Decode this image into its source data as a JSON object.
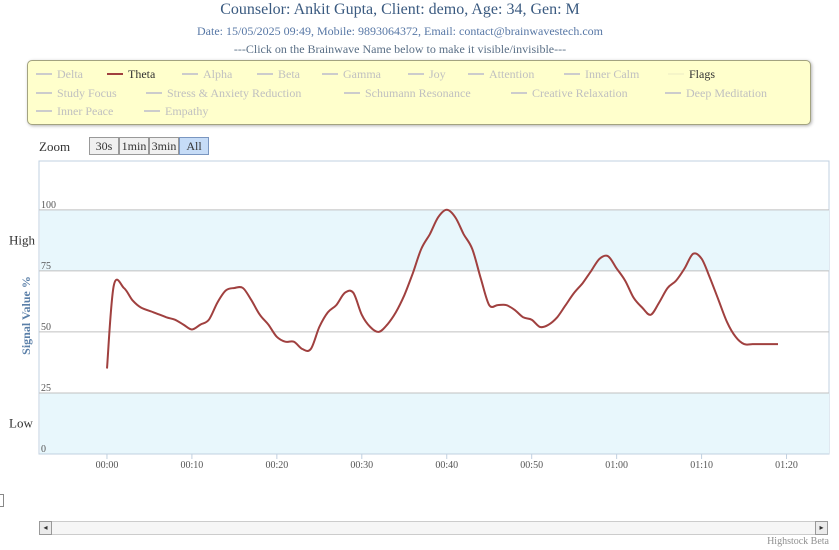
{
  "header": {
    "title": "Counselor: Ankit Gupta, Client: demo, Age: 34, Gen: M",
    "subtitle": "Date: 15/05/2025 09:49, Mobile: 9893064372, Email: contact@brainwavestech.com",
    "hint": "---Click on the Brainwave Name below to make it visible/invisible---"
  },
  "legend": {
    "items": [
      {
        "label": "Delta",
        "visible": false
      },
      {
        "label": "Theta",
        "visible": true,
        "color": "#a0403f"
      },
      {
        "label": "Alpha",
        "visible": false
      },
      {
        "label": "Beta",
        "visible": false
      },
      {
        "label": "Gamma",
        "visible": false
      },
      {
        "label": "Joy",
        "visible": false
      },
      {
        "label": "Attention",
        "visible": false
      },
      {
        "label": "Inner Calm",
        "visible": false
      },
      {
        "label": "Flags",
        "visible": true,
        "color": "#f5f5c8"
      },
      {
        "label": "Study Focus",
        "visible": false
      },
      {
        "label": "Stress & Anxiety Reduction",
        "visible": false
      },
      {
        "label": "Schumann Resonance",
        "visible": false
      },
      {
        "label": "Creative Relaxation",
        "visible": false
      },
      {
        "label": "Deep Meditation",
        "visible": false
      },
      {
        "label": "Inner Peace",
        "visible": false
      },
      {
        "label": "Empathy",
        "visible": false
      }
    ]
  },
  "zoom": {
    "label": "Zoom",
    "buttons": [
      "30s",
      "1min",
      "3min",
      "All"
    ],
    "active": "All"
  },
  "chart_data": {
    "type": "line",
    "ylabel": "Signal Value %",
    "ylim": [
      0,
      120
    ],
    "yticks": [
      0,
      25,
      50,
      75,
      100
    ],
    "bands": [
      {
        "label": "High",
        "from": 75,
        "to": 100,
        "color": "#e8f7fc"
      },
      {
        "label": "Low",
        "from": 0,
        "to": 25,
        "color": "#e8f7fc"
      }
    ],
    "xlim_seconds": [
      -8,
      85
    ],
    "xticks": [
      {
        "label": "00:00",
        "t": 0
      },
      {
        "label": "00:10",
        "t": 10
      },
      {
        "label": "00:20",
        "t": 20
      },
      {
        "label": "00:30",
        "t": 30
      },
      {
        "label": "00:40",
        "t": 40
      },
      {
        "label": "00:50",
        "t": 50
      },
      {
        "label": "01:00",
        "t": 60
      },
      {
        "label": "01:10",
        "t": 70
      },
      {
        "label": "01:20",
        "t": 80
      }
    ],
    "series": [
      {
        "name": "Theta",
        "color": "#a0403f",
        "t": [
          0,
          0.8,
          2,
          3,
          4,
          5.5,
          7,
          8,
          9,
          10,
          11,
          12,
          13,
          14,
          15,
          16,
          17,
          18,
          19,
          20,
          21,
          22,
          23,
          24,
          25,
          26,
          27,
          28,
          29,
          30,
          31,
          32,
          33,
          34,
          35,
          36,
          37,
          38,
          39,
          40,
          41,
          42,
          43,
          44,
          45,
          46,
          47,
          48,
          49,
          50,
          51,
          52,
          53,
          54,
          55,
          56,
          57,
          58,
          59,
          60,
          61,
          62,
          63,
          64,
          65,
          66,
          67,
          68,
          69,
          70,
          71,
          72,
          73,
          74,
          75,
          76,
          77,
          78,
          79
        ],
        "values": [
          35,
          69,
          68,
          63,
          60,
          58,
          56,
          55,
          53,
          51,
          53,
          55,
          62,
          67,
          68,
          68,
          63,
          57,
          53,
          48,
          46,
          46,
          43,
          43,
          52,
          58,
          61,
          66,
          66,
          57,
          52,
          50,
          53,
          58,
          65,
          74,
          84,
          90,
          97,
          100,
          97,
          90,
          84,
          72,
          61,
          61,
          61,
          59,
          56,
          55,
          52,
          53,
          56,
          61,
          66,
          70,
          75,
          80,
          81,
          76,
          71,
          64,
          60,
          57,
          62,
          68,
          71,
          76,
          82,
          80,
          72,
          63,
          54,
          48,
          45,
          45,
          45,
          45,
          45
        ]
      }
    ]
  },
  "navigator": {
    "left_arrow": "◂",
    "right_arrow": "▸"
  },
  "credit": "Highstock Beta"
}
